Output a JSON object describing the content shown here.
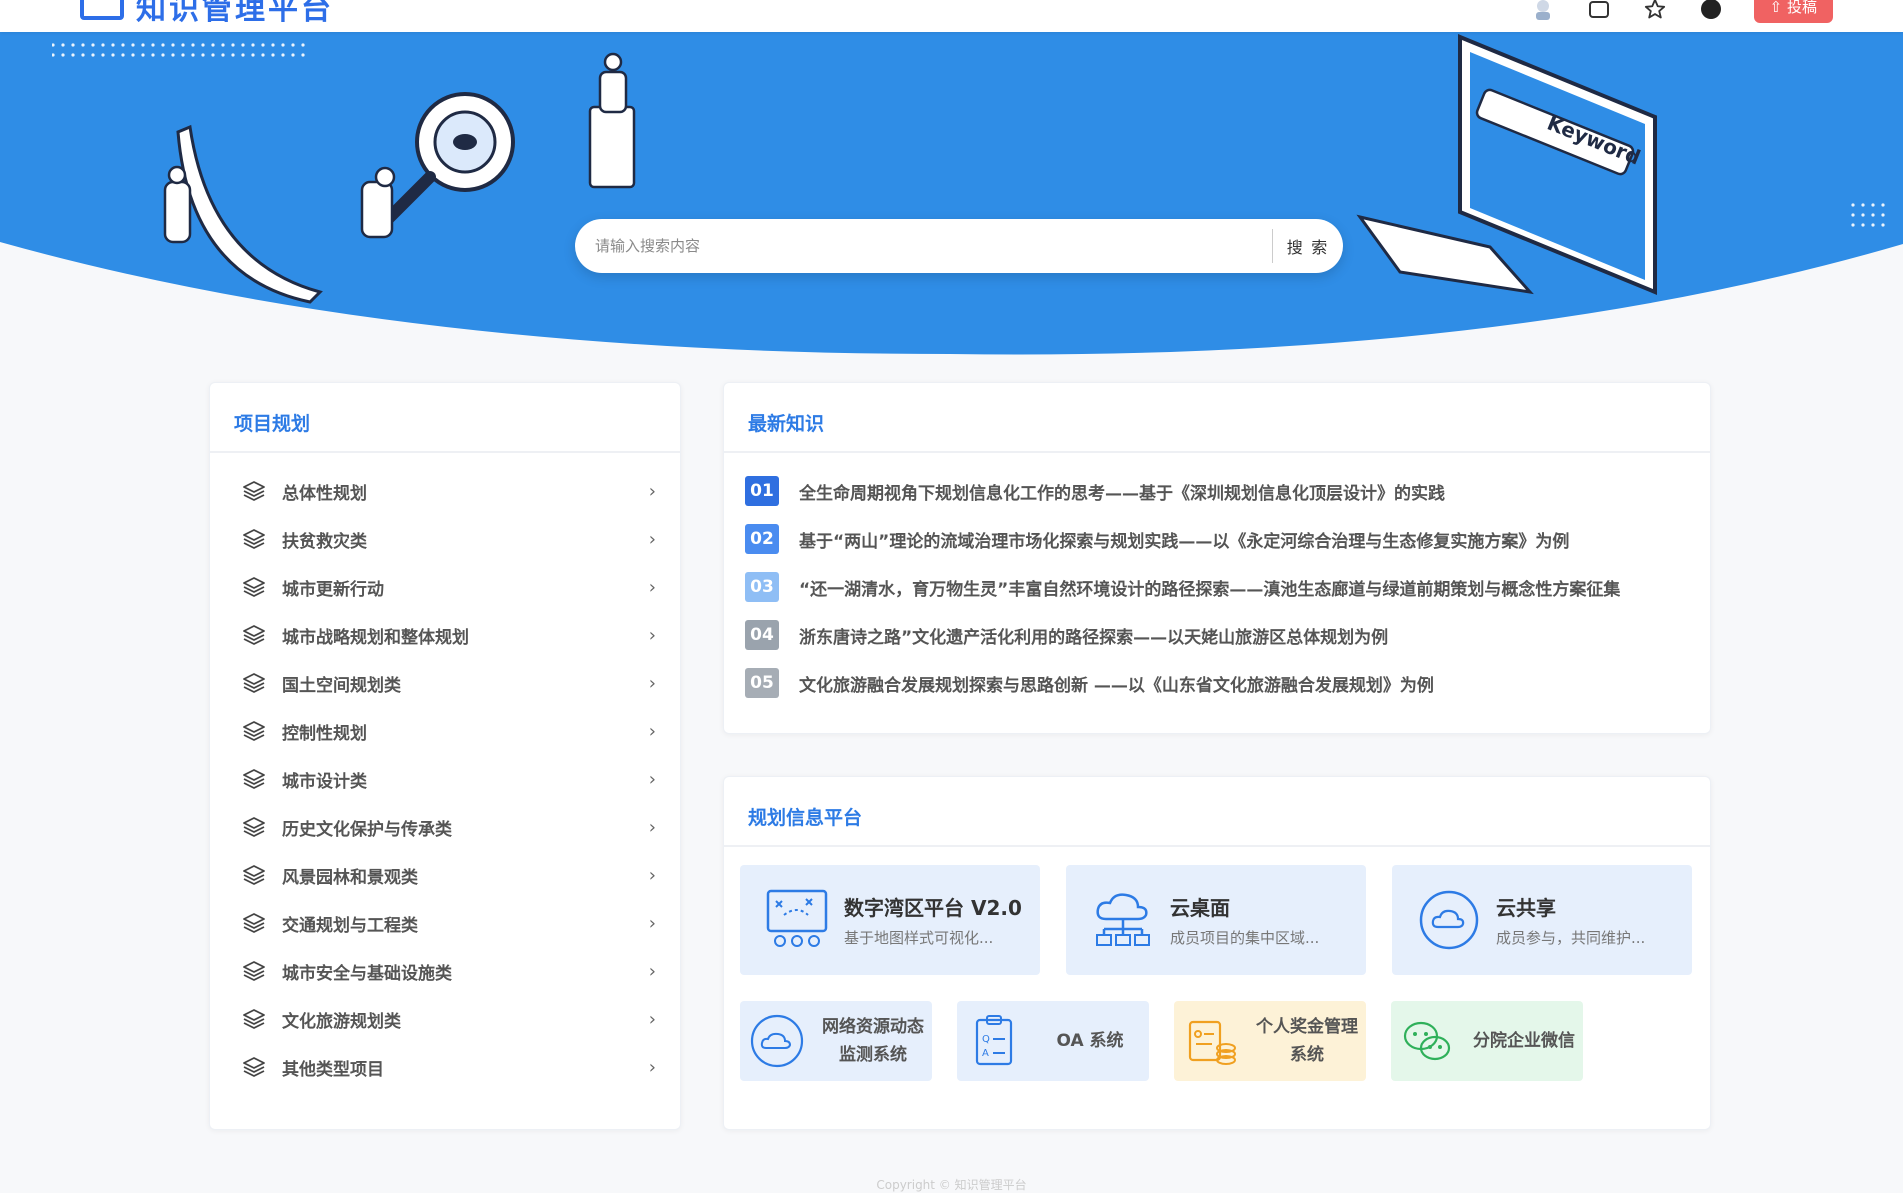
{
  "topbar": {
    "app_name": "知识管理平台",
    "publish_label": "投稿",
    "icons": [
      "avatar-icon",
      "message-icon",
      "star-icon",
      "help-icon"
    ]
  },
  "search": {
    "placeholder": "请输入搜索内容",
    "button_label": "搜 索"
  },
  "hero": {
    "screen_text": "Keyword"
  },
  "project": {
    "title": "项目规划",
    "items": [
      {
        "label": "总体性规划"
      },
      {
        "label": "扶贫救灾类"
      },
      {
        "label": "城市更新行动"
      },
      {
        "label": "城市战略规划和整体规划"
      },
      {
        "label": "国土空间规划类"
      },
      {
        "label": "控制性规划"
      },
      {
        "label": "城市设计类"
      },
      {
        "label": "历史文化保护与传承类"
      },
      {
        "label": "风景园林和景观类"
      },
      {
        "label": "交通规划与工程类"
      },
      {
        "label": "城市安全与基础设施类"
      },
      {
        "label": "文化旅游规划类"
      },
      {
        "label": "其他类型项目"
      }
    ]
  },
  "news": {
    "title": "最新知识",
    "items": [
      {
        "num": "01",
        "color": "#2f6fe0",
        "text": "全生命周期视角下规划信息化工作的思考——基于《深圳规划信息化顶层设计》的实践"
      },
      {
        "num": "02",
        "color": "#4a8cf0",
        "text": "基于“两山”理论的流域治理市场化探索与规划实践——以《永定河综合治理与生态修复实施方案》为例"
      },
      {
        "num": "03",
        "color": "#8fbef5",
        "text": "“还一湖清水，育万物生灵”丰富自然环境设计的路径探索——滇池生态廊道与绿道前期策划与概念性方案征集"
      },
      {
        "num": "04",
        "color": "#9aa3ad",
        "text": "浙东唐诗之路”文化遗产活化利用的路径探索——以天姥山旅游区总体规划为例"
      },
      {
        "num": "05",
        "color": "#a6adb5",
        "text": "文化旅游融合发展规划探索与思路创新 ——以《山东省文化旅游融合发展规划》为例"
      }
    ]
  },
  "platform": {
    "title": "规划信息平台",
    "big": [
      {
        "name": "数字湾区平台 V2.0",
        "desc": "基于地图样式可视化...",
        "icon": "map-team-icon"
      },
      {
        "name": "云桌面",
        "desc": "成员项目的集中区域...",
        "icon": "cloud-network-icon"
      },
      {
        "name": "云共享",
        "desc": "成员参与，共同维护...",
        "icon": "cloud-share-icon"
      }
    ],
    "small": [
      {
        "name": "网络资源动态监测系统",
        "icon": "cloud-monitor-icon",
        "bg": "#e6effc",
        "stroke": "#2d7be5"
      },
      {
        "name": "OA 系统",
        "icon": "qa-document-icon",
        "bg": "#e6effc",
        "stroke": "#2d7be5"
      },
      {
        "name": "个人奖金管理系统",
        "icon": "bonus-coins-icon",
        "bg": "#fdf2d7",
        "stroke": "#f0a020"
      },
      {
        "name": "分院企业微信",
        "icon": "wechat-icon",
        "bg": "#e4f7ea",
        "stroke": "#2fb05a"
      }
    ]
  },
  "footer": {
    "text": "Copyright © 知识管理平台"
  }
}
